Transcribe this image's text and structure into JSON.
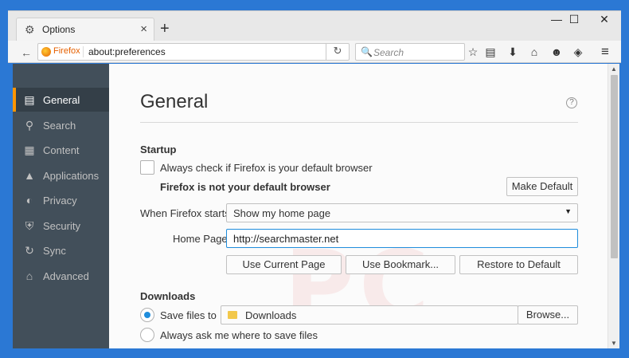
{
  "tab": {
    "title": "Options",
    "close": "×",
    "gear": "⚙"
  },
  "new_tab": "+",
  "window_controls": {
    "minimize": "—",
    "maximize": "☐",
    "close": "✕"
  },
  "navbar": {
    "back": "←",
    "identity": "Firefox",
    "url": "about:preferences",
    "reload": "↻",
    "search_placeholder": "Search",
    "search_glyph": "🔍",
    "toolbar_icons": {
      "bookmark_star": "☆",
      "reading_list": "▤",
      "downloads": "⬇",
      "home": "⌂",
      "chat": "☻",
      "pocket": "◈",
      "menu": "≡"
    }
  },
  "sidebar": {
    "items": [
      {
        "label": "General",
        "icon": "▤",
        "active": true
      },
      {
        "label": "Search",
        "icon": "⚲",
        "active": false
      },
      {
        "label": "Content",
        "icon": "▦",
        "active": false
      },
      {
        "label": "Applications",
        "icon": "▲",
        "active": false
      },
      {
        "label": "Privacy",
        "icon": "◐",
        "active": false
      },
      {
        "label": "Security",
        "icon": "⛨",
        "active": false
      },
      {
        "label": "Sync",
        "icon": "↻",
        "active": false
      },
      {
        "label": "Advanced",
        "icon": "⌂",
        "active": false
      }
    ]
  },
  "main": {
    "title": "General",
    "help": "?",
    "startup": {
      "heading": "Startup",
      "default_check_label": "Always check if Firefox is your default browser",
      "not_default_text": "Firefox is not your default browser",
      "make_default_button": "Make Default",
      "starts_label": "When Firefox starts:",
      "starts_value": "Show my home page",
      "dropdown_arrow": "▼",
      "home_page_label": "Home Page:",
      "home_page_value": "http://searchmaster.net",
      "use_current_button": "Use Current Page",
      "use_bookmark_button": "Use Bookmark...",
      "restore_default_button": "Restore to Default"
    },
    "downloads": {
      "heading": "Downloads",
      "save_files_label": "Save files to",
      "folder_value": "Downloads",
      "browse_button": "Browse...",
      "always_ask_label": "Always ask me where to save files"
    }
  },
  "scrollbar": {
    "up": "▲",
    "down": "▼"
  },
  "colors": {
    "window_frame": "#2b78d4",
    "sidebar_bg": "#424f5a",
    "sidebar_active": "#343f48",
    "accent": "#ff9500",
    "focus_blue": "#1f8ddc"
  }
}
